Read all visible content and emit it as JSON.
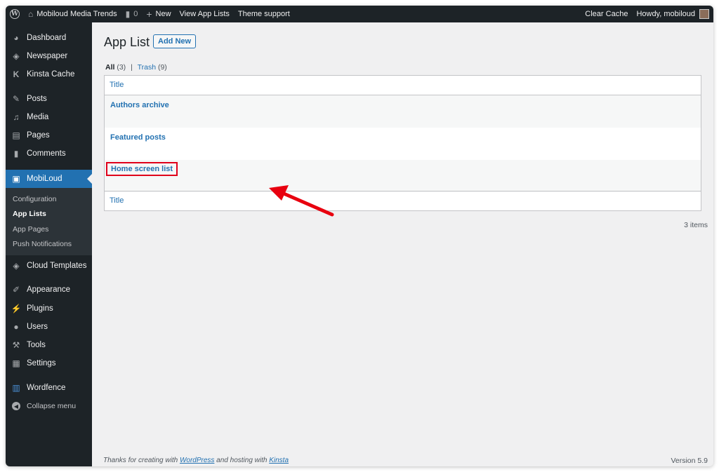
{
  "adminbar": {
    "site_name": "Mobiloud Media Trends",
    "comments_count": "0",
    "new_label": "New",
    "view_label": "View App Lists",
    "theme_label": "Theme support",
    "clear_cache": "Clear Cache",
    "howdy": "Howdy, mobiloud"
  },
  "sidebar": {
    "items": [
      {
        "label": "Dashboard",
        "icon": "dashboard-icon"
      },
      {
        "label": "Newspaper",
        "icon": "newspaper-icon"
      },
      {
        "label": "Kinsta Cache",
        "icon": "kinsta-icon"
      },
      {
        "label": "Posts",
        "icon": "pin-icon"
      },
      {
        "label": "Media",
        "icon": "media-icon"
      },
      {
        "label": "Pages",
        "icon": "pages-icon"
      },
      {
        "label": "Comments",
        "icon": "comment-icon"
      },
      {
        "label": "MobiLoud",
        "icon": "mobiloud-icon"
      },
      {
        "label": "Cloud Templates",
        "icon": "cloud-templates-icon"
      },
      {
        "label": "Appearance",
        "icon": "brush-icon"
      },
      {
        "label": "Plugins",
        "icon": "plugin-icon"
      },
      {
        "label": "Users",
        "icon": "user-icon"
      },
      {
        "label": "Tools",
        "icon": "wrench-icon"
      },
      {
        "label": "Settings",
        "icon": "settings-icon"
      },
      {
        "label": "Wordfence",
        "icon": "wordfence-icon"
      },
      {
        "label": "Collapse menu",
        "icon": "collapse-icon"
      }
    ],
    "submenu": [
      "Configuration",
      "App Lists",
      "App Pages",
      "Push Notifications"
    ]
  },
  "main": {
    "title": "App List",
    "add_new": "Add New",
    "filters": {
      "all": "All",
      "all_count": "(3)",
      "sep": "|",
      "trash": "Trash",
      "trash_count": "(9)"
    },
    "column_header": "Title",
    "rows": [
      "Authors archive",
      "Featured posts",
      "Home screen list"
    ],
    "items_count": "3 items"
  },
  "footer": {
    "text1": "Thanks for creating with ",
    "wordpress": "WordPress",
    "text2": " and hosting with ",
    "kinsta": "Kinsta",
    "version": "Version 5.9"
  },
  "colors": {
    "accent": "#2271b1",
    "sidebar": "#1d2327",
    "highlight": "#e0001b"
  }
}
